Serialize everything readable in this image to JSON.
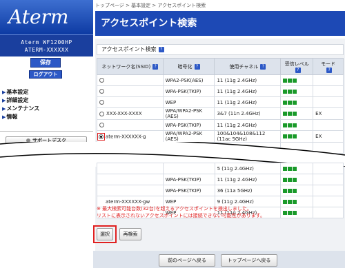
{
  "sidebar": {
    "logo": "Aterm",
    "model_line1": "Aterm WF1200HP",
    "model_line2": "ATERM-XXXXXX",
    "save_label": "保存",
    "logout_label": "ログアウト",
    "nav": [
      {
        "label": "基本設定"
      },
      {
        "label": "詳細設定"
      },
      {
        "label": "メンテナンス"
      },
      {
        "label": "情報"
      }
    ],
    "support_label": "サポートデスク"
  },
  "header": {
    "breadcrumb": "トップページ > 基本設定 > アクセスポイント検索",
    "title": "アクセスポイント検索"
  },
  "section": {
    "label": "アクセスポイント検索",
    "help": "?"
  },
  "table": {
    "columns": [
      "ネットワーク名(SSID)",
      "暗号化",
      "使用チャネル",
      "受信レベル",
      "モード"
    ],
    "rows_top": [
      {
        "ssid": "",
        "enc": "WPA2-PSK(AES)",
        "ch": "11 (11g 2.4GHz)",
        "mode": ""
      },
      {
        "ssid": "",
        "enc": "WPA-PSK(TKIP)",
        "ch": "11 (11g 2.4GHz)",
        "mode": ""
      },
      {
        "ssid": "",
        "enc": "WEP",
        "ch": "11 (11g 2.4GHz)",
        "mode": ""
      },
      {
        "ssid": "XXX-XXX-XXXX",
        "enc": "WPA/WPA2-PSK (AES)",
        "ch": "3&7 (11n 2.4GHz)",
        "mode": "EX"
      },
      {
        "ssid": "",
        "enc": "WPA-PSK(TKIP)",
        "ch": "11 (11g 2.4GHz)",
        "mode": ""
      },
      {
        "ssid": "aterm-XXXXXX-g",
        "enc": "WPA/WPA2-PSK (AES)",
        "ch": "100&104&108&112 (11ac 5GHz)",
        "mode": "EX",
        "selected": true
      },
      {
        "ssid": "aterm-XXXXXX-g",
        "enc": "WPA/WPA2-PSK",
        "ch": "",
        "mode": ""
      }
    ],
    "rows_bottom": [
      {
        "ssid": "",
        "enc": "",
        "ch": "5 (11g 2.4GHz)",
        "mode": ""
      },
      {
        "ssid": "",
        "enc": "WPA-PSK(TKIP)",
        "ch": "11 (11g 2.4GHz)",
        "mode": ""
      },
      {
        "ssid": "",
        "enc": "WPA-PSK(TKIP)",
        "ch": "36 (11a 5GHz)",
        "mode": ""
      },
      {
        "ssid": "aterm-XXXXXX-gw",
        "enc": "WEP",
        "ch": "9 (11g 2.4GHz)",
        "mode": ""
      },
      {
        "ssid": "",
        "enc": "WEP",
        "ch": "11 (11g 2.4GHz)",
        "mode": ""
      }
    ]
  },
  "warning": {
    "line1": "※ 最大検索可能台数(32台)を超えるアクセスポイントを検出しました。",
    "line2": "リストに表示されないアクセスポイントには接続できない可能性があります。"
  },
  "buttons": {
    "select": "選択",
    "research": "再検索",
    "back": "前のページへ戻る",
    "top": "トップページへ戻る"
  },
  "colors": {
    "brand_blue": "#1d49b5",
    "signal_green": "#1a9a2a",
    "warning_red": "#e02020"
  }
}
